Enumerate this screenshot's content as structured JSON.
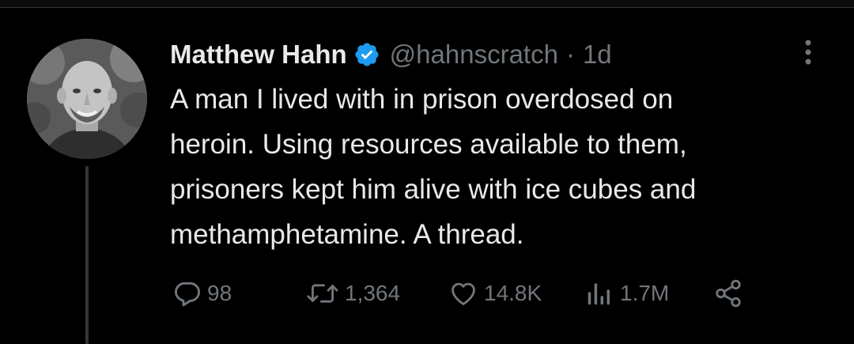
{
  "tweet": {
    "author": {
      "name": "Matthew Hahn",
      "handle": "@hahnscratch",
      "verified": true
    },
    "separator": "·",
    "time": "1d",
    "text_lines": [
      "A man I lived with in prison overdosed on",
      "heroin. Using resources available to them,",
      "prisoners kept him alive with ice cubes and",
      "methamphetamine. A thread."
    ]
  },
  "actions": {
    "replies": "98",
    "retweets": "1,364",
    "likes": "14.8K",
    "views": "1.7M"
  },
  "icons": {
    "verified": "verified-badge-icon",
    "more": "more-options-icon",
    "reply": "reply-icon",
    "retweet": "retweet-icon",
    "like": "heart-icon",
    "views": "views-icon",
    "share": "share-icon"
  },
  "colors": {
    "background": "#000000",
    "text": "#e7e9ea",
    "secondary": "#71767b",
    "verified": "#1d9bf0",
    "thread_line": "#333639"
  }
}
